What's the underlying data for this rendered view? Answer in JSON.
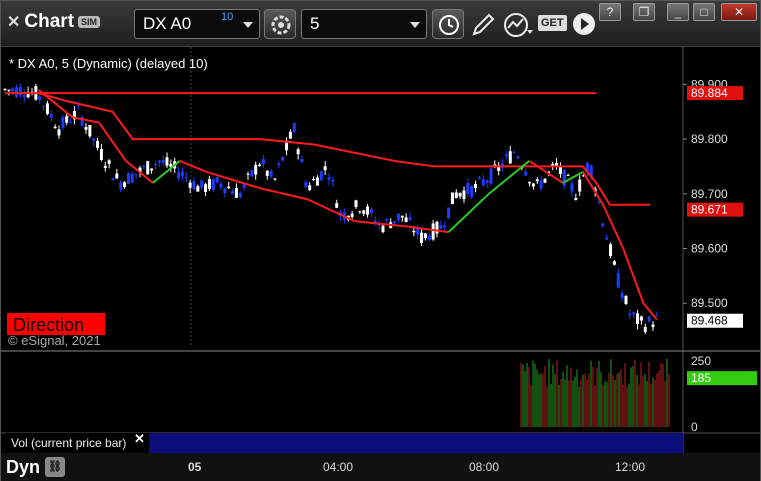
{
  "toolbar": {
    "app_title": "Chart",
    "sim_badge": "SIM",
    "symbol": "DX A0",
    "symbol_sup": "10",
    "interval": "5",
    "icons": [
      "settings-icon",
      "clock-icon",
      "pencil-icon",
      "study-icon",
      "get-icon",
      "play-icon"
    ],
    "get_label": "GET",
    "window_buttons": [
      "?",
      "❐",
      "_",
      "□",
      "✕"
    ]
  },
  "chart": {
    "header": "* DX A0, 5 (Dynamic) (delayed 10)",
    "direction_label": "Direction",
    "copyright": "© eSignal, 2021",
    "colors": {
      "background": "#000000",
      "up_bar": "#ffffff",
      "down_bar": "#1a3dff",
      "ma_red": "#ff1a1a",
      "ma_green": "#22cc22",
      "price_marker_red": "#e01010",
      "vol_marker_green": "#33cc11",
      "study_bar": "#0c0c7a"
    },
    "price_axis": {
      "ticks": [
        "89.900",
        "89.800",
        "89.700",
        "89.600",
        "89.500"
      ],
      "markers": [
        {
          "value": "89.884",
          "style": "red"
        },
        {
          "value": "89.671",
          "style": "red"
        },
        {
          "value": "89.468",
          "style": "white"
        }
      ]
    },
    "volume_axis": {
      "ticks": [
        "250",
        "0"
      ],
      "marker": "185"
    },
    "time_axis": [
      "05",
      "04:00",
      "08:00",
      "12:00"
    ],
    "study_label": "Vol (current price bar)",
    "bottom_label": "Dyn"
  },
  "chart_data": {
    "type": "line",
    "description_series": [
      {
        "name": "upper-stop-line",
        "points": [
          [
            0,
            89.884
          ],
          [
            0.88,
            89.884
          ]
        ]
      },
      {
        "name": "trail-line",
        "points": [
          [
            0.05,
            89.884
          ],
          [
            0.09,
            89.87
          ],
          [
            0.16,
            89.85
          ],
          [
            0.19,
            89.8
          ],
          [
            0.38,
            89.8
          ],
          [
            0.46,
            89.79
          ],
          [
            0.5,
            89.78
          ],
          [
            0.58,
            89.76
          ],
          [
            0.64,
            89.75
          ],
          [
            0.86,
            89.75
          ],
          [
            0.88,
            89.72
          ],
          [
            0.9,
            89.68
          ],
          [
            0.96,
            89.68
          ]
        ]
      },
      {
        "name": "ma-line",
        "points": [
          [
            0.05,
            89.89
          ],
          [
            0.1,
            89.84
          ],
          [
            0.14,
            89.83
          ],
          [
            0.18,
            89.76
          ],
          [
            0.22,
            89.72
          ],
          [
            0.26,
            89.76
          ],
          [
            0.3,
            89.74
          ],
          [
            0.38,
            89.71
          ],
          [
            0.45,
            89.69
          ],
          [
            0.52,
            89.65
          ],
          [
            0.6,
            89.64
          ],
          [
            0.66,
            89.63
          ],
          [
            0.72,
            89.7
          ],
          [
            0.78,
            89.76
          ],
          [
            0.83,
            89.72
          ],
          [
            0.86,
            89.74
          ],
          [
            0.89,
            89.68
          ],
          [
            0.92,
            89.6
          ],
          [
            0.95,
            89.5
          ],
          [
            0.97,
            89.47
          ]
        ]
      },
      {
        "name": "price",
        "points": [
          [
            0,
            89.89
          ],
          [
            0.03,
            89.89
          ],
          [
            0.05,
            89.88
          ],
          [
            0.08,
            89.82
          ],
          [
            0.11,
            89.85
          ],
          [
            0.14,
            89.78
          ],
          [
            0.17,
            89.72
          ],
          [
            0.2,
            89.74
          ],
          [
            0.23,
            89.76
          ],
          [
            0.26,
            89.74
          ],
          [
            0.29,
            89.71
          ],
          [
            0.32,
            89.72
          ],
          [
            0.35,
            89.7
          ],
          [
            0.38,
            89.76
          ],
          [
            0.4,
            89.72
          ],
          [
            0.43,
            89.82
          ],
          [
            0.45,
            89.71
          ],
          [
            0.48,
            89.75
          ],
          [
            0.5,
            89.66
          ],
          [
            0.53,
            89.68
          ],
          [
            0.56,
            89.64
          ],
          [
            0.59,
            89.66
          ],
          [
            0.62,
            89.62
          ],
          [
            0.65,
            89.64
          ],
          [
            0.67,
            89.7
          ],
          [
            0.7,
            89.71
          ],
          [
            0.73,
            89.74
          ],
          [
            0.76,
            89.78
          ],
          [
            0.79,
            89.71
          ],
          [
            0.82,
            89.75
          ],
          [
            0.85,
            89.7
          ],
          [
            0.87,
            89.76
          ],
          [
            0.89,
            89.65
          ],
          [
            0.91,
            89.55
          ],
          [
            0.93,
            89.48
          ],
          [
            0.95,
            89.46
          ],
          [
            0.97,
            89.47
          ]
        ]
      }
    ],
    "ylim": [
      89.42,
      89.95
    ]
  }
}
